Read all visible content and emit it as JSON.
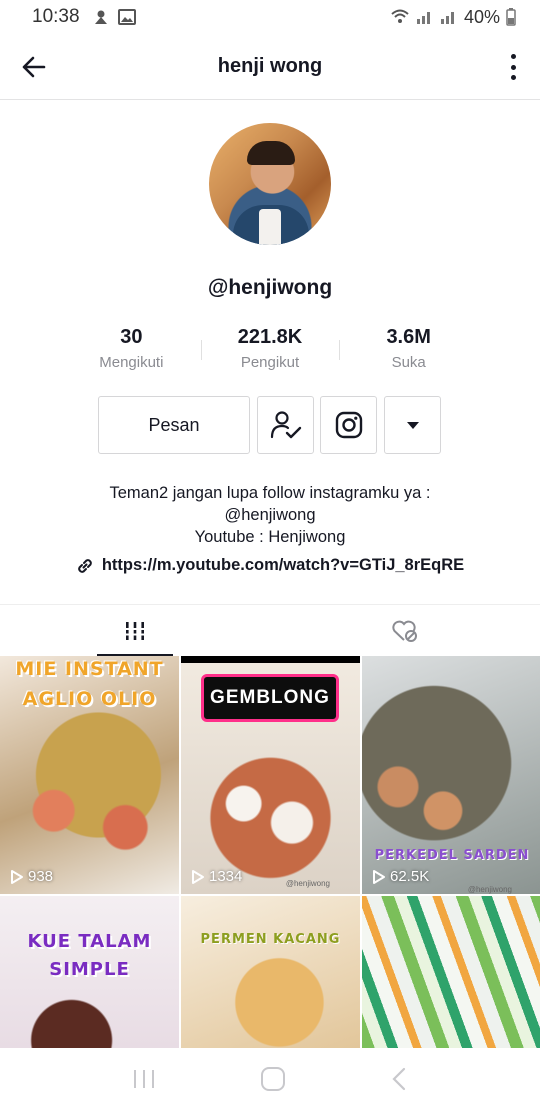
{
  "status_bar": {
    "time": "10:38",
    "battery": "40%",
    "icons": [
      "notification-icon",
      "image-icon",
      "wifi-icon",
      "signal-icon",
      "signal-icon",
      "battery-icon"
    ]
  },
  "header": {
    "title": "henji wong",
    "back_icon": "arrow-left-icon",
    "more_icon": "more-vertical-icon"
  },
  "profile": {
    "username": "@henjiwong",
    "stats": [
      {
        "value": "30",
        "label": "Mengikuti"
      },
      {
        "value": "221.8K",
        "label": "Pengikut"
      },
      {
        "value": "3.6M",
        "label": "Suka"
      }
    ],
    "message_button": "Pesan",
    "bio_lines": [
      "Teman2 jangan lupa follow instagramku ya :",
      "@henjiwong",
      "Youtube : Henjiwong"
    ],
    "link": "https://m.youtube.com/watch?v=GTiJ_8rEqRE"
  },
  "tabs": [
    {
      "icon": "videos-grid-icon",
      "active": true
    },
    {
      "icon": "liked-videos-icon",
      "active": false
    }
  ],
  "videos": [
    {
      "title_lines": [
        "MIE INSTANT",
        "AGLIO OLIO"
      ],
      "views": "938"
    },
    {
      "title_lines": [
        "GEMBLONG"
      ],
      "views": "1334",
      "watermark": "@henjiwong"
    },
    {
      "title_lines": [
        "PERKEDEL SARDEN"
      ],
      "views": "62.5K",
      "watermark": "@henjiwong"
    },
    {
      "title_lines": [
        "KUE TALAM",
        "SIMPLE"
      ]
    },
    {
      "title_lines": [
        "PERMEN KACANG"
      ]
    },
    {
      "title_lines": []
    }
  ],
  "nav": [
    "recent-apps-icon",
    "home-icon",
    "back-icon"
  ],
  "colors": {
    "text": "#161823",
    "secondary": "#8a8b91",
    "border": "#d6d6d8"
  }
}
